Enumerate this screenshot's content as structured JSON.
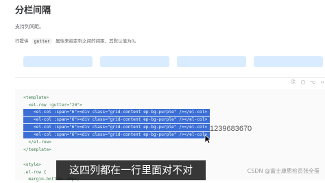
{
  "page": {
    "title": "分栏间隔",
    "description": "支持列间距。",
    "gutter_text_before": "行提供",
    "gutter_code": "gutter",
    "gutter_text_after": "属性来指定列之间的间距，其默认值为0。"
  },
  "demo": {
    "columns": 4,
    "color": "#d9ecff"
  },
  "toolbar": {
    "icons": [
      "copy-icon",
      "code-expand-icon",
      "source-icon",
      "expand-icon"
    ]
  },
  "code_lines": [
    "<template>",
    "  <el-row :gutter=\"20\">",
    "    <el-col :span=\"6\"><div class=\"grid-content ep-bg-purple\" /></el-col>",
    "    <el-col :span=\"6\"><div class=\"grid-content ep-bg-purple\" /></el-col>",
    "    <el-col :span=\"6\"><div class=\"grid-content ep-bg-purple\" /></el-col>",
    "    <el-col :span=\"6\"><div class=\"grid-content ep-bg-purple\" /></el-col>",
    "  </el-row>",
    "</template>",
    "",
    "<style>",
    ".el-row {",
    "  margin-bottom: 20px;"
  ],
  "overlay": {
    "number": "1239683670",
    "subtitle": "这四列都在一行里面对不对",
    "watermark": "CSDN @富士康质检员张全蛋"
  },
  "colors": {
    "selection": "#3b6fd6",
    "column": "#d9ecff",
    "subtitle_bg": "#141414"
  }
}
